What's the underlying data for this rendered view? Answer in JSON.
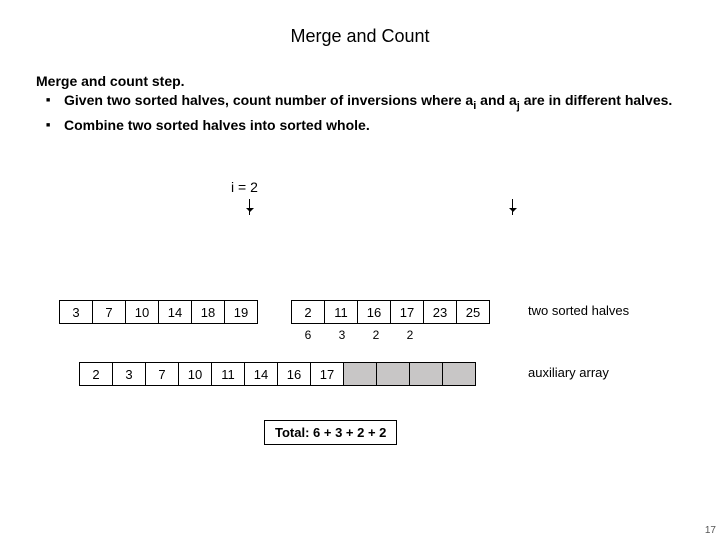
{
  "title": "Merge and Count",
  "step_head": "Merge and count step.",
  "bullets": [
    "Given two sorted halves, count number of inversions where a_i and a_j are in different halves.",
    "Combine two sorted halves into sorted whole."
  ],
  "bullet1_pre": "Given two sorted halves, count number of inversions where a",
  "bullet1_sub1": "i",
  "bullet1_mid": " and a",
  "bullet1_sub2": "j",
  "bullet1_post": " are in different halves.",
  "bullet2": "Combine two sorted halves into sorted whole.",
  "i_marker_label": "i = 2",
  "halves_left": [
    "3",
    "7",
    "10",
    "14",
    "18",
    "19"
  ],
  "halves_right": [
    "2",
    "11",
    "16",
    "17",
    "23",
    "25"
  ],
  "halves_label": "two sorted halves",
  "counts_under_right": [
    "6",
    "3",
    "2",
    "2",
    "",
    ""
  ],
  "aux": [
    "2",
    "3",
    "7",
    "10",
    "11",
    "14",
    "16",
    "17",
    "",
    "",
    "",
    ""
  ],
  "aux_label": "auxiliary array",
  "total_label": "Total:  6 + 3 + 2 + 2",
  "page_number": "17"
}
